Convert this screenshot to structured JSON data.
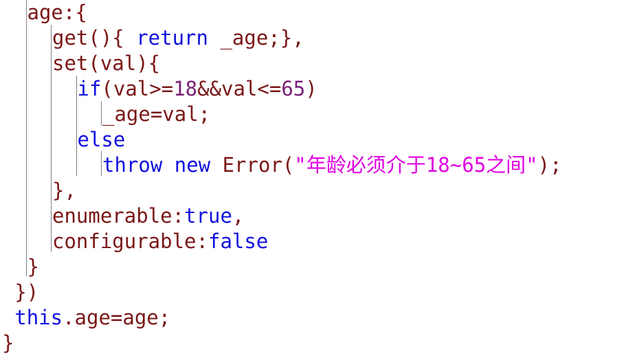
{
  "colors": {
    "background": "#ffffff",
    "guide": "#7f7f7f",
    "plain": "#7a1717",
    "keyword": "#1010e0",
    "number": "#7a1f7a",
    "string": "#e000e0"
  },
  "code_lines": [
    {
      "indent": 1,
      "tokens": [
        {
          "text": "age:{",
          "kind": "plain"
        }
      ]
    },
    {
      "indent": 2,
      "tokens": [
        {
          "text": "get(){ ",
          "kind": "plain"
        },
        {
          "text": "return",
          "kind": "keyword"
        },
        {
          "text": " _age;},",
          "kind": "plain"
        }
      ]
    },
    {
      "indent": 2,
      "tokens": [
        {
          "text": "set(val){",
          "kind": "plain"
        }
      ]
    },
    {
      "indent": 3,
      "tokens": [
        {
          "text": "if",
          "kind": "keyword"
        },
        {
          "text": "(val>=",
          "kind": "plain"
        },
        {
          "text": "18",
          "kind": "number"
        },
        {
          "text": "&&val<=",
          "kind": "plain"
        },
        {
          "text": "65",
          "kind": "number"
        },
        {
          "text": ")",
          "kind": "plain"
        }
      ]
    },
    {
      "indent": 4,
      "tokens": [
        {
          "text": "_age=val;",
          "kind": "plain"
        }
      ]
    },
    {
      "indent": 3,
      "tokens": [
        {
          "text": "else",
          "kind": "keyword"
        }
      ]
    },
    {
      "indent": 4,
      "tokens": [
        {
          "text": "throw",
          "kind": "keyword"
        },
        {
          "text": " ",
          "kind": "plain"
        },
        {
          "text": "new",
          "kind": "keyword"
        },
        {
          "text": " Error(",
          "kind": "plain"
        },
        {
          "text": "\"年龄必须介于18~65之间\"",
          "kind": "string"
        },
        {
          "text": ");",
          "kind": "plain"
        }
      ]
    },
    {
      "indent": 2,
      "tokens": [
        {
          "text": "},",
          "kind": "plain"
        }
      ]
    },
    {
      "indent": 2,
      "tokens": [
        {
          "text": "enumerable:",
          "kind": "plain"
        },
        {
          "text": "true",
          "kind": "keyword"
        },
        {
          "text": ",",
          "kind": "plain"
        }
      ]
    },
    {
      "indent": 2,
      "tokens": [
        {
          "text": "configurable:",
          "kind": "plain"
        },
        {
          "text": "false",
          "kind": "keyword"
        }
      ]
    },
    {
      "indent": 1,
      "tokens": [
        {
          "text": "}",
          "kind": "plain"
        }
      ]
    },
    {
      "indent": 0.5,
      "tokens": [
        {
          "text": "})",
          "kind": "plain"
        }
      ]
    },
    {
      "indent": 0.5,
      "tokens": [
        {
          "text": "this",
          "kind": "keyword"
        },
        {
          "text": ".age=age;",
          "kind": "plain"
        }
      ]
    },
    {
      "indent": 0,
      "tokens": [
        {
          "text": "}",
          "kind": "plain"
        }
      ]
    }
  ]
}
